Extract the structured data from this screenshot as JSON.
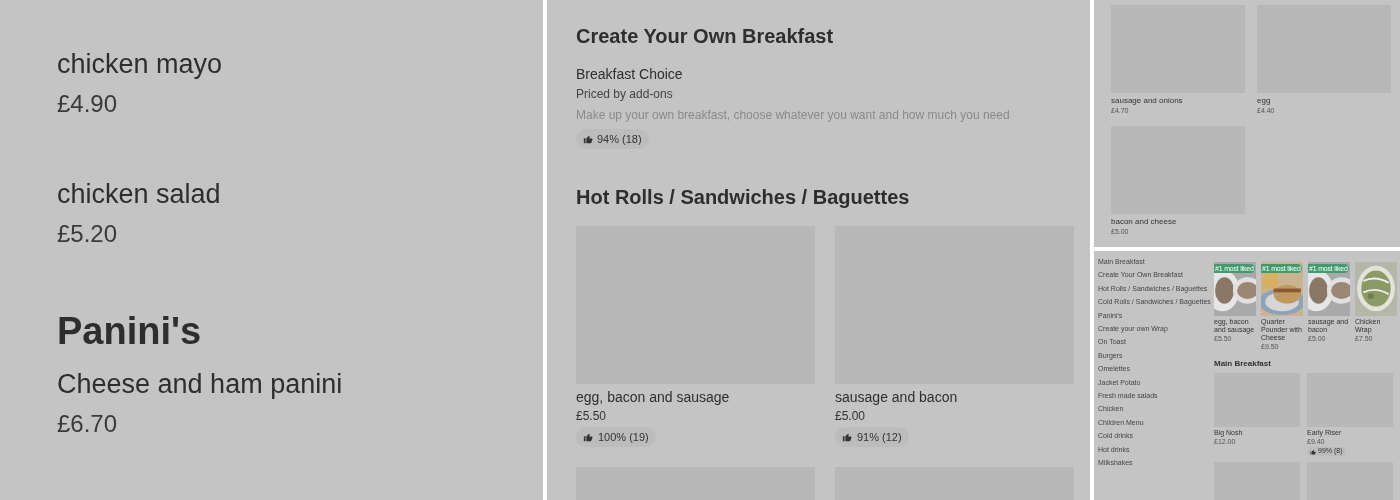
{
  "left_panel": {
    "sections": [
      {
        "items": [
          {
            "name": "chicken mayo",
            "price": "£4.90"
          },
          {
            "name": "chicken salad",
            "price": "£5.20"
          }
        ]
      },
      {
        "title": "Panini's",
        "items": [
          {
            "name": "Cheese and ham panini",
            "price": "£6.70"
          }
        ]
      }
    ]
  },
  "middle_panel": {
    "sections": [
      {
        "title": "Create Your Own Breakfast",
        "items": [
          {
            "name": "Breakfast Choice",
            "subtitle": "Priced by add-ons",
            "description": "Make up your own breakfast, choose whatever you want and how much you need",
            "rating": "94% (18)"
          }
        ]
      },
      {
        "title": "Hot Rolls / Sandwiches / Baguettes",
        "items": [
          {
            "kind": "item",
            "name": "egg, bacon and sausage",
            "price": "£5.50",
            "rating": "100% (19)"
          },
          {
            "kind": "item",
            "name": "sausage and bacon",
            "price": "£5.00",
            "rating": "91% (12)"
          },
          {
            "kind": "picture"
          },
          {
            "kind": "picture"
          }
        ]
      }
    ]
  },
  "top_right_panel": {
    "items": [
      {
        "name": "sausage and onions",
        "price": "£4.70"
      },
      {
        "name": "egg",
        "price": "£4.40"
      },
      {
        "name": "bacon and cheese",
        "price": "£5.00"
      }
    ]
  },
  "bottom_right_panel": {
    "sidebar": {
      "items": [
        "Main Breakfast",
        "Create Your Own Breakfast",
        "Hot Rolls / Sandwiches / Baguettes",
        "Cold Rolls / Sandwiches / Baguettes",
        "Panini's",
        "Create your own Wrap",
        "On Toast",
        "Burgers",
        "Omelettes",
        "Jacket Potato",
        "Fresh made salads",
        "Chicken",
        "Children Menu",
        "Cold drinks",
        "Hot drinks",
        "Milkshakes"
      ]
    },
    "featured": [
      {
        "name": "egg, bacon and sausage",
        "price": "£5.50",
        "badge": "#1 most liked"
      },
      {
        "name": "Quarter Pounder with Cheese",
        "price": "£9.50",
        "badge": "#1 most liked"
      },
      {
        "name": "sausage and bacon",
        "price": "£5.00",
        "badge": "#1 most liked"
      },
      {
        "name": "Chicken Wrap",
        "price": "£7.50"
      }
    ],
    "section": {
      "title": "Main Breakfast",
      "items": [
        {
          "kind": "item",
          "name": "Big Nosh",
          "price": "£12.00"
        },
        {
          "kind": "item",
          "name": "Early Riser",
          "price": "£9.40",
          "rating": "99% (8)"
        },
        {
          "kind": "picture"
        },
        {
          "kind": "picture"
        }
      ]
    }
  }
}
